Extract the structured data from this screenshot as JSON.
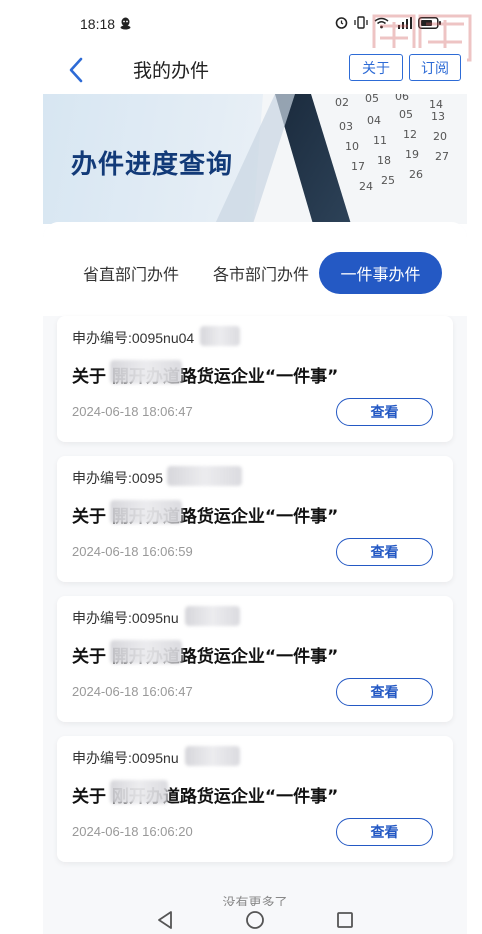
{
  "status": {
    "time": "18:18",
    "icons": [
      "qq-icon",
      "alarm-icon",
      "vibrate-icon",
      "wifi-icon",
      "5g-signal-icon",
      "battery-icon"
    ]
  },
  "header": {
    "title": "我的办件",
    "about_label": "关于",
    "subscribe_label": "订阅",
    "accent": "#2d6bd6"
  },
  "banner": {
    "title": "办件进度查询"
  },
  "tabs": [
    {
      "label": "省直部门办件",
      "active": false
    },
    {
      "label": "各市部门办件",
      "active": false
    },
    {
      "label": "一件事办件",
      "active": true
    }
  ],
  "cards": [
    {
      "no": "申办编号:0095nu04",
      "title": "关于        開开办道路货运企业“一件事”",
      "time": "2024-06-18 18:06:47",
      "view": "查看"
    },
    {
      "no": "申办编号:0095",
      "title": "关于        開开办道路货运企业“一件事”",
      "time": "2024-06-18 16:06:59",
      "view": "查看"
    },
    {
      "no": "申办编号:0095nu",
      "title": "关于        開开办道路货运企业“一件事”",
      "time": "2024-06-18 16:06:47",
      "view": "查看"
    },
    {
      "no": "申办编号:0095nu",
      "title": "关于        刚开办道路货运企业“一件事”",
      "time": "2024-06-18 16:06:20",
      "view": "查看"
    }
  ],
  "footer": {
    "no_more": "没有更多了"
  },
  "colors": {
    "primary": "#2459c4",
    "banner_text": "#123a78",
    "background": "#f7f8fa"
  }
}
